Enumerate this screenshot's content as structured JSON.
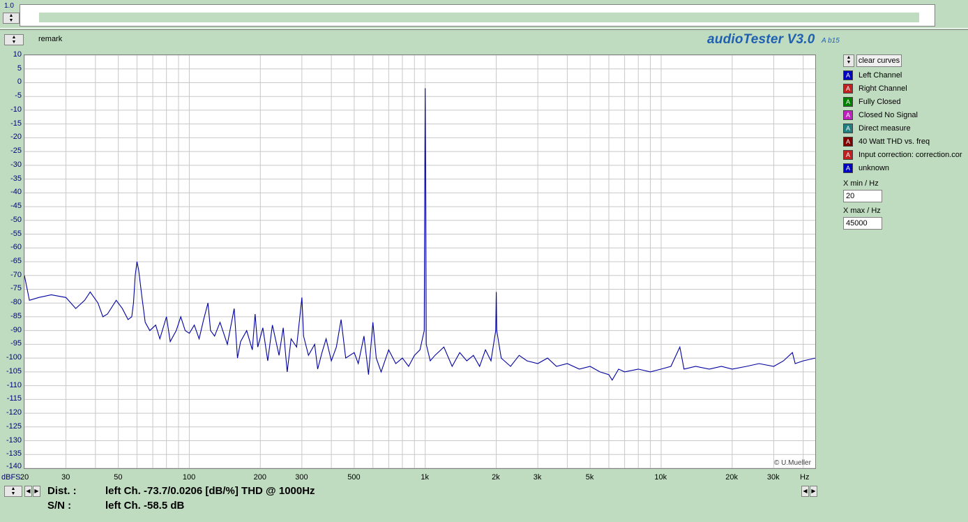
{
  "top": {
    "scale_label": "1.0"
  },
  "header": {
    "remark_label": "remark",
    "app_title": "audioTester V3.0",
    "app_version": "A b15"
  },
  "plot": {
    "credit": "© U.Mueller",
    "y_unit": "dBFS",
    "x_unit": "Hz"
  },
  "legend": {
    "clear_label": "clear curves",
    "swatch_glyph": "A",
    "items": [
      {
        "label": "Left Channel",
        "color": "#0000c0"
      },
      {
        "label": "Right Channel",
        "color": "#c02020"
      },
      {
        "label": "Fully Closed",
        "color": "#008000"
      },
      {
        "label": "Closed No Signal",
        "color": "#c020c0"
      },
      {
        "label": "Direct measure",
        "color": "#208080"
      },
      {
        "label": "40 Watt THD vs. freq",
        "color": "#800000"
      },
      {
        "label": "Input correction: correction.cor",
        "color": "#c02020"
      },
      {
        "label": "unknown",
        "color": "#0000c0"
      }
    ]
  },
  "xrange": {
    "min_label": "X min / Hz",
    "min_value": "20",
    "max_label": "X max / Hz",
    "max_value": "45000"
  },
  "status": {
    "dist_key": "Dist. :",
    "dist_value": "left Ch. -73.7/0.0206 [dB/%] THD @ 1000Hz",
    "sn_key": "S/N :",
    "sn_value": "left Ch. -58.5 dB"
  },
  "chart_data": {
    "type": "line",
    "xscale": "log",
    "xlim": [
      20,
      45000
    ],
    "ylim": [
      -140,
      10
    ],
    "grid": true,
    "y_ticks": [
      10,
      5,
      0,
      -5,
      -10,
      -15,
      -20,
      -25,
      -30,
      -35,
      -40,
      -45,
      -50,
      -55,
      -60,
      -65,
      -70,
      -75,
      -80,
      -85,
      -90,
      -95,
      -100,
      -105,
      -110,
      -115,
      -120,
      -125,
      -130,
      -135,
      -140
    ],
    "x_ticks": [
      {
        "v": 20,
        "label": "20"
      },
      {
        "v": 30,
        "label": "30"
      },
      {
        "v": 50,
        "label": "50"
      },
      {
        "v": 100,
        "label": "100"
      },
      {
        "v": 200,
        "label": "200"
      },
      {
        "v": 300,
        "label": "300"
      },
      {
        "v": 500,
        "label": "500"
      },
      {
        "v": 1000,
        "label": "1k"
      },
      {
        "v": 2000,
        "label": "2k"
      },
      {
        "v": 3000,
        "label": "3k"
      },
      {
        "v": 5000,
        "label": "5k"
      },
      {
        "v": 10000,
        "label": "10k"
      },
      {
        "v": 20000,
        "label": "20k"
      },
      {
        "v": 30000,
        "label": "30k"
      }
    ],
    "series": [
      {
        "color": "#0000a0",
        "points": [
          [
            20,
            -70
          ],
          [
            21,
            -79
          ],
          [
            23,
            -78
          ],
          [
            26,
            -77
          ],
          [
            30,
            -78
          ],
          [
            33,
            -82
          ],
          [
            36,
            -79
          ],
          [
            38,
            -76
          ],
          [
            41,
            -80
          ],
          [
            43,
            -85
          ],
          [
            45,
            -84
          ],
          [
            49,
            -79
          ],
          [
            52,
            -82
          ],
          [
            55,
            -86
          ],
          [
            57,
            -85
          ],
          [
            58,
            -80
          ],
          [
            59,
            -70
          ],
          [
            60,
            -65
          ],
          [
            61,
            -68
          ],
          [
            63,
            -78
          ],
          [
            65,
            -87
          ],
          [
            68,
            -90
          ],
          [
            72,
            -88
          ],
          [
            75,
            -93
          ],
          [
            80,
            -85
          ],
          [
            83,
            -94
          ],
          [
            88,
            -90
          ],
          [
            92,
            -85
          ],
          [
            96,
            -90
          ],
          [
            100,
            -91
          ],
          [
            105,
            -88
          ],
          [
            110,
            -93
          ],
          [
            115,
            -86
          ],
          [
            120,
            -80
          ],
          [
            123,
            -90
          ],
          [
            128,
            -92
          ],
          [
            135,
            -87
          ],
          [
            145,
            -95
          ],
          [
            155,
            -82
          ],
          [
            160,
            -100
          ],
          [
            165,
            -94
          ],
          [
            175,
            -90
          ],
          [
            185,
            -97
          ],
          [
            190,
            -84
          ],
          [
            195,
            -96
          ],
          [
            205,
            -89
          ],
          [
            215,
            -101
          ],
          [
            225,
            -88
          ],
          [
            240,
            -99
          ],
          [
            250,
            -89
          ],
          [
            260,
            -105
          ],
          [
            270,
            -93
          ],
          [
            285,
            -96
          ],
          [
            300,
            -78
          ],
          [
            305,
            -92
          ],
          [
            320,
            -99
          ],
          [
            340,
            -95
          ],
          [
            350,
            -104
          ],
          [
            365,
            -98
          ],
          [
            380,
            -93
          ],
          [
            400,
            -101
          ],
          [
            420,
            -96
          ],
          [
            440,
            -86
          ],
          [
            460,
            -100
          ],
          [
            500,
            -98
          ],
          [
            520,
            -102
          ],
          [
            550,
            -92
          ],
          [
            575,
            -106
          ],
          [
            600,
            -87
          ],
          [
            620,
            -100
          ],
          [
            650,
            -105
          ],
          [
            700,
            -97
          ],
          [
            750,
            -102
          ],
          [
            800,
            -100
          ],
          [
            850,
            -103
          ],
          [
            900,
            -99
          ],
          [
            950,
            -97
          ],
          [
            990,
            -90
          ],
          [
            995,
            -40
          ],
          [
            1000,
            -2
          ],
          [
            1005,
            -40
          ],
          [
            1010,
            -95
          ],
          [
            1050,
            -101
          ],
          [
            1100,
            -99
          ],
          [
            1200,
            -96
          ],
          [
            1300,
            -103
          ],
          [
            1400,
            -98
          ],
          [
            1500,
            -101
          ],
          [
            1600,
            -99
          ],
          [
            1700,
            -103
          ],
          [
            1800,
            -97
          ],
          [
            1900,
            -101
          ],
          [
            1990,
            -90
          ],
          [
            2000,
            -76
          ],
          [
            2010,
            -90
          ],
          [
            2100,
            -100
          ],
          [
            2300,
            -103
          ],
          [
            2500,
            -99
          ],
          [
            2700,
            -101
          ],
          [
            3000,
            -102
          ],
          [
            3300,
            -100
          ],
          [
            3600,
            -103
          ],
          [
            4000,
            -102
          ],
          [
            4500,
            -104
          ],
          [
            5000,
            -103
          ],
          [
            5500,
            -105
          ],
          [
            6000,
            -106
          ],
          [
            6200,
            -108
          ],
          [
            6600,
            -104
          ],
          [
            7000,
            -105
          ],
          [
            8000,
            -104
          ],
          [
            9000,
            -105
          ],
          [
            10000,
            -104
          ],
          [
            11000,
            -103
          ],
          [
            12000,
            -96
          ],
          [
            12500,
            -104
          ],
          [
            14000,
            -103
          ],
          [
            16000,
            -104
          ],
          [
            18000,
            -103
          ],
          [
            20000,
            -104
          ],
          [
            23000,
            -103
          ],
          [
            26000,
            -102
          ],
          [
            30000,
            -103
          ],
          [
            33000,
            -101
          ],
          [
            36000,
            -98
          ],
          [
            37000,
            -102
          ],
          [
            40000,
            -101
          ],
          [
            45000,
            -100
          ]
        ]
      }
    ]
  }
}
